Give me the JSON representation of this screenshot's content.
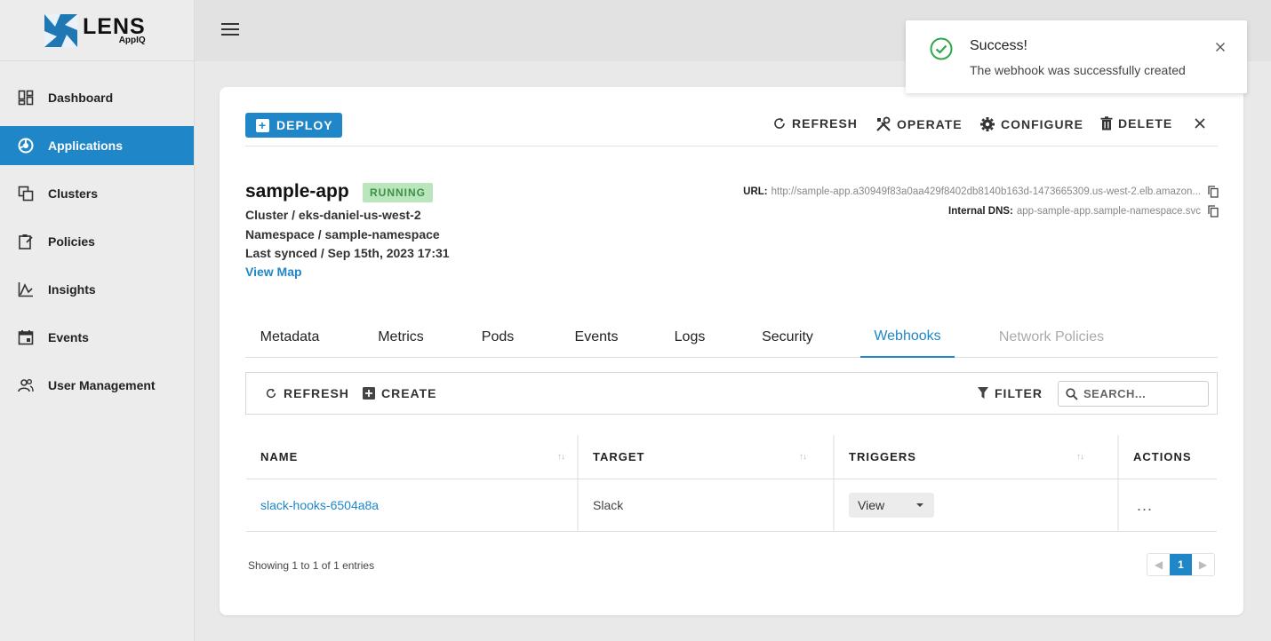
{
  "brand": {
    "name": "LENS",
    "sub": "AppIQ",
    "color": "#1f86c8"
  },
  "sidebar": {
    "items": [
      {
        "label": "Dashboard",
        "icon": "dashboard-icon",
        "active": false
      },
      {
        "label": "Applications",
        "icon": "applications-icon",
        "active": true
      },
      {
        "label": "Clusters",
        "icon": "clusters-icon",
        "active": false
      },
      {
        "label": "Policies",
        "icon": "policies-icon",
        "active": false
      },
      {
        "label": "Insights",
        "icon": "insights-icon",
        "active": false
      },
      {
        "label": "Events",
        "icon": "events-icon",
        "active": false
      },
      {
        "label": "User Management",
        "icon": "users-icon",
        "active": false
      }
    ]
  },
  "toolbar": {
    "deploy": "DEPLOY",
    "refresh": "REFRESH",
    "operate": "OPERATE",
    "configure": "CONFIGURE",
    "delete": "DELETE"
  },
  "app": {
    "name": "sample-app",
    "status": "RUNNING",
    "cluster": "Cluster / eks-daniel-us-west-2",
    "namespace": "Namespace / sample-namespace",
    "last_synced": "Last synced / Sep 15th, 2023 17:31",
    "view_map": "View Map",
    "url_label": "URL:",
    "url_value": "http://sample-app.a30949f83a0aa429f8402db8140b163d-1473665309.us-west-2.elb.amazon...",
    "dns_label": "Internal DNS:",
    "dns_value": "app-sample-app.sample-namespace.svc"
  },
  "tabs": [
    "Metadata",
    "Metrics",
    "Pods",
    "Events",
    "Logs",
    "Security",
    "Webhooks",
    "Network Policies"
  ],
  "active_tab": "Webhooks",
  "subtoolbar": {
    "refresh": "REFRESH",
    "create": "CREATE",
    "filter": "FILTER",
    "search_placeholder": "SEARCH..."
  },
  "table": {
    "headers": {
      "name": "NAME",
      "target": "TARGET",
      "triggers": "TRIGGERS",
      "actions": "ACTIONS"
    },
    "rows": [
      {
        "name": "slack-hooks-6504a8a",
        "target": "Slack",
        "triggers": "View",
        "actions": "..."
      }
    ]
  },
  "footer": {
    "showing": "Showing 1 to 1 of 1 entries",
    "page": "1"
  },
  "toast": {
    "title": "Success!",
    "message": "The webhook was successfully created",
    "color": "#2ea84a"
  }
}
